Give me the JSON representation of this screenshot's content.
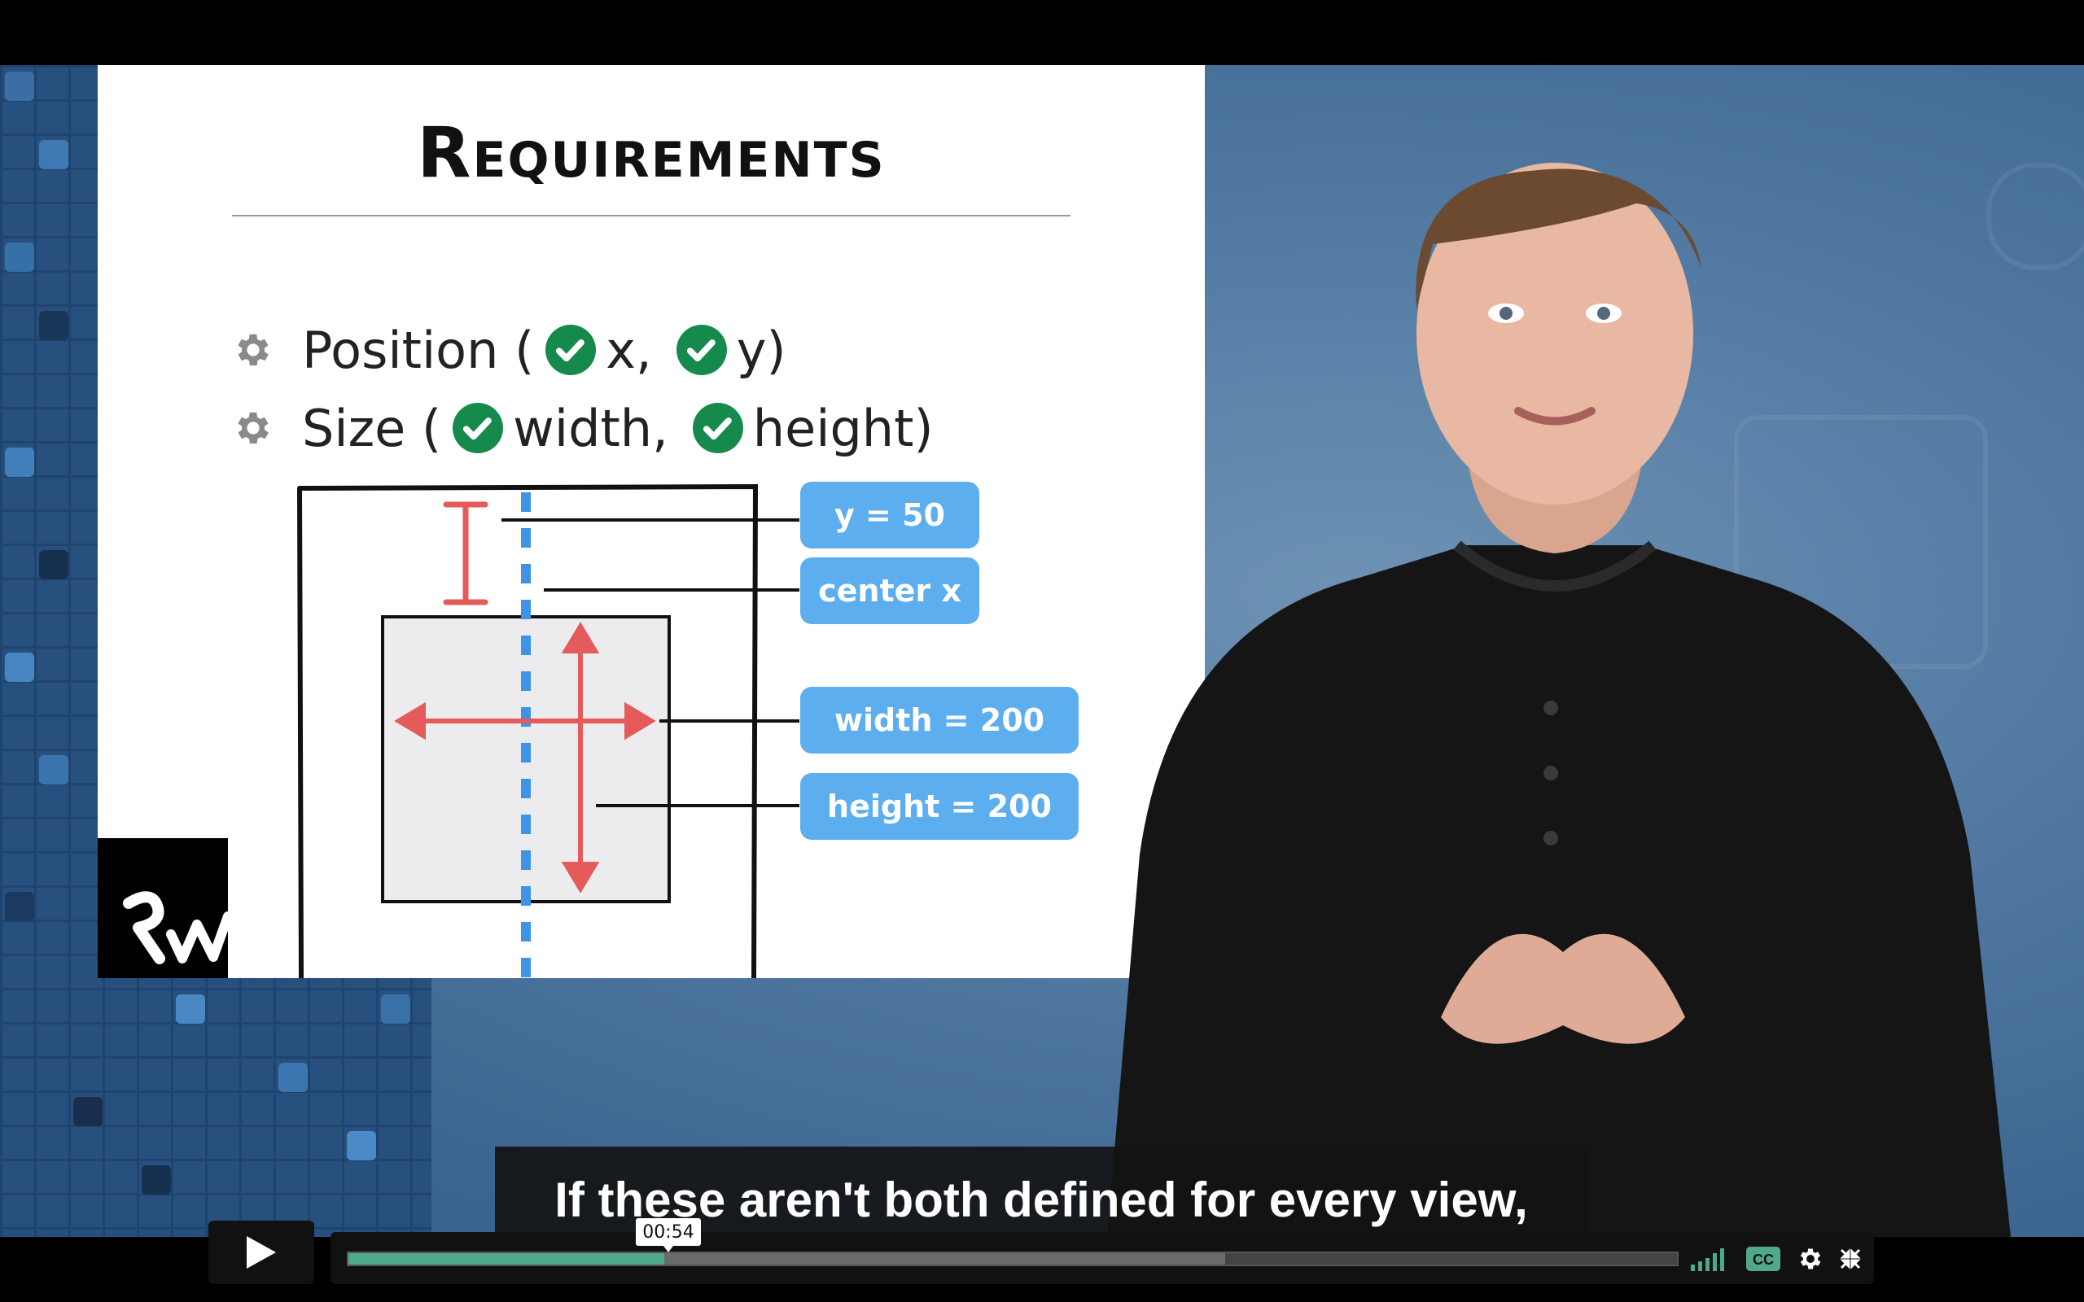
{
  "slide": {
    "title": "Requirements",
    "bullets": [
      {
        "label_before": "Position (",
        "items": [
          "x,",
          "y)"
        ]
      },
      {
        "label_before": "Size (",
        "items": [
          "width,",
          "height)"
        ]
      }
    ],
    "labels": {
      "y": "y = 50",
      "center_x": "center x",
      "width": "width = 200",
      "height": "height = 200"
    }
  },
  "subtitle": "If these aren't both defined for every view,",
  "player": {
    "current_time": "00:54",
    "progress_fraction": 0.2375,
    "buffered_fraction": 0.66
  },
  "colors": {
    "check_green": "#168a4d",
    "label_blue": "#5daeef",
    "arrow_red": "#e55a5a",
    "progress_green": "#4fa88a",
    "guide_blue": "#3d94e6"
  },
  "icons": [
    "gear-icon",
    "check-icon",
    "play-icon",
    "volume-icon",
    "cc-icon",
    "settings-icon",
    "fullscreen-exit-icon",
    "raywenderlich-logo"
  ]
}
